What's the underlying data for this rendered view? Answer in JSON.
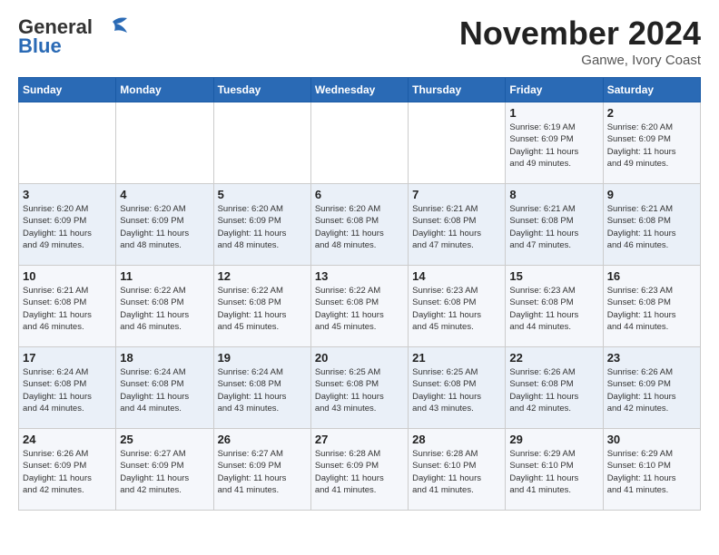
{
  "header": {
    "logo_line1": "General",
    "logo_line2": "Blue",
    "month": "November 2024",
    "location": "Ganwe, Ivory Coast"
  },
  "days_of_week": [
    "Sunday",
    "Monday",
    "Tuesday",
    "Wednesday",
    "Thursday",
    "Friday",
    "Saturday"
  ],
  "weeks": [
    [
      {
        "day": "",
        "info": ""
      },
      {
        "day": "",
        "info": ""
      },
      {
        "day": "",
        "info": ""
      },
      {
        "day": "",
        "info": ""
      },
      {
        "day": "",
        "info": ""
      },
      {
        "day": "1",
        "info": "Sunrise: 6:19 AM\nSunset: 6:09 PM\nDaylight: 11 hours\nand 49 minutes."
      },
      {
        "day": "2",
        "info": "Sunrise: 6:20 AM\nSunset: 6:09 PM\nDaylight: 11 hours\nand 49 minutes."
      }
    ],
    [
      {
        "day": "3",
        "info": "Sunrise: 6:20 AM\nSunset: 6:09 PM\nDaylight: 11 hours\nand 49 minutes."
      },
      {
        "day": "4",
        "info": "Sunrise: 6:20 AM\nSunset: 6:09 PM\nDaylight: 11 hours\nand 48 minutes."
      },
      {
        "day": "5",
        "info": "Sunrise: 6:20 AM\nSunset: 6:09 PM\nDaylight: 11 hours\nand 48 minutes."
      },
      {
        "day": "6",
        "info": "Sunrise: 6:20 AM\nSunset: 6:08 PM\nDaylight: 11 hours\nand 48 minutes."
      },
      {
        "day": "7",
        "info": "Sunrise: 6:21 AM\nSunset: 6:08 PM\nDaylight: 11 hours\nand 47 minutes."
      },
      {
        "day": "8",
        "info": "Sunrise: 6:21 AM\nSunset: 6:08 PM\nDaylight: 11 hours\nand 47 minutes."
      },
      {
        "day": "9",
        "info": "Sunrise: 6:21 AM\nSunset: 6:08 PM\nDaylight: 11 hours\nand 46 minutes."
      }
    ],
    [
      {
        "day": "10",
        "info": "Sunrise: 6:21 AM\nSunset: 6:08 PM\nDaylight: 11 hours\nand 46 minutes."
      },
      {
        "day": "11",
        "info": "Sunrise: 6:22 AM\nSunset: 6:08 PM\nDaylight: 11 hours\nand 46 minutes."
      },
      {
        "day": "12",
        "info": "Sunrise: 6:22 AM\nSunset: 6:08 PM\nDaylight: 11 hours\nand 45 minutes."
      },
      {
        "day": "13",
        "info": "Sunrise: 6:22 AM\nSunset: 6:08 PM\nDaylight: 11 hours\nand 45 minutes."
      },
      {
        "day": "14",
        "info": "Sunrise: 6:23 AM\nSunset: 6:08 PM\nDaylight: 11 hours\nand 45 minutes."
      },
      {
        "day": "15",
        "info": "Sunrise: 6:23 AM\nSunset: 6:08 PM\nDaylight: 11 hours\nand 44 minutes."
      },
      {
        "day": "16",
        "info": "Sunrise: 6:23 AM\nSunset: 6:08 PM\nDaylight: 11 hours\nand 44 minutes."
      }
    ],
    [
      {
        "day": "17",
        "info": "Sunrise: 6:24 AM\nSunset: 6:08 PM\nDaylight: 11 hours\nand 44 minutes."
      },
      {
        "day": "18",
        "info": "Sunrise: 6:24 AM\nSunset: 6:08 PM\nDaylight: 11 hours\nand 44 minutes."
      },
      {
        "day": "19",
        "info": "Sunrise: 6:24 AM\nSunset: 6:08 PM\nDaylight: 11 hours\nand 43 minutes."
      },
      {
        "day": "20",
        "info": "Sunrise: 6:25 AM\nSunset: 6:08 PM\nDaylight: 11 hours\nand 43 minutes."
      },
      {
        "day": "21",
        "info": "Sunrise: 6:25 AM\nSunset: 6:08 PM\nDaylight: 11 hours\nand 43 minutes."
      },
      {
        "day": "22",
        "info": "Sunrise: 6:26 AM\nSunset: 6:08 PM\nDaylight: 11 hours\nand 42 minutes."
      },
      {
        "day": "23",
        "info": "Sunrise: 6:26 AM\nSunset: 6:09 PM\nDaylight: 11 hours\nand 42 minutes."
      }
    ],
    [
      {
        "day": "24",
        "info": "Sunrise: 6:26 AM\nSunset: 6:09 PM\nDaylight: 11 hours\nand 42 minutes."
      },
      {
        "day": "25",
        "info": "Sunrise: 6:27 AM\nSunset: 6:09 PM\nDaylight: 11 hours\nand 42 minutes."
      },
      {
        "day": "26",
        "info": "Sunrise: 6:27 AM\nSunset: 6:09 PM\nDaylight: 11 hours\nand 41 minutes."
      },
      {
        "day": "27",
        "info": "Sunrise: 6:28 AM\nSunset: 6:09 PM\nDaylight: 11 hours\nand 41 minutes."
      },
      {
        "day": "28",
        "info": "Sunrise: 6:28 AM\nSunset: 6:10 PM\nDaylight: 11 hours\nand 41 minutes."
      },
      {
        "day": "29",
        "info": "Sunrise: 6:29 AM\nSunset: 6:10 PM\nDaylight: 11 hours\nand 41 minutes."
      },
      {
        "day": "30",
        "info": "Sunrise: 6:29 AM\nSunset: 6:10 PM\nDaylight: 11 hours\nand 41 minutes."
      }
    ]
  ]
}
